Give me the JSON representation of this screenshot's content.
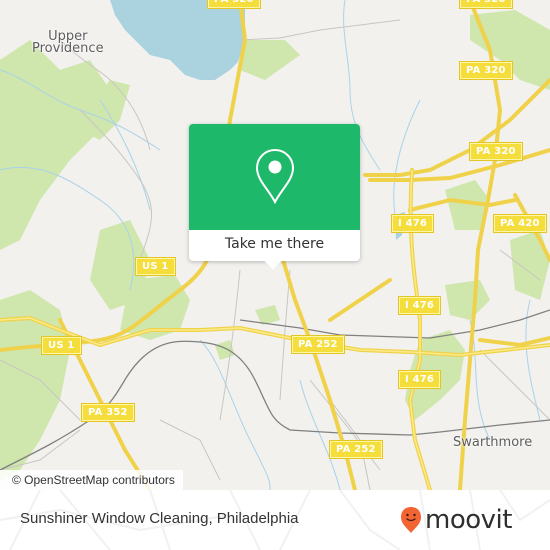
{
  "map": {
    "colors": {
      "background": "#f2f1ee",
      "water": "#aad3df",
      "park": "#c8e3a4",
      "road_major": "#f5dd3c",
      "road_minor": "#bdbcb8",
      "rail": "#7a7a7a",
      "stream": "#a9d2ea"
    },
    "place_labels": [
      {
        "name": "upper-providence",
        "line1": "Upper",
        "line2": "Providence"
      },
      {
        "name": "swarthmore",
        "line1": "Swarthmore",
        "line2": ""
      }
    ],
    "road_shields": [
      {
        "label": "PA 320"
      },
      {
        "label": "PA 320"
      },
      {
        "label": "PA 320"
      },
      {
        "label": "I 476"
      },
      {
        "label": "PA 420"
      },
      {
        "label": "US 1"
      },
      {
        "label": "US 1"
      },
      {
        "label": "I 476"
      },
      {
        "label": "PA 252"
      },
      {
        "label": "I 476"
      },
      {
        "label": "PA 352"
      },
      {
        "label": "PA 252"
      }
    ],
    "attribution": "© OpenStreetMap contributors"
  },
  "popup": {
    "icon": "map-pin-icon",
    "color": "#1db86a",
    "cta_label": "Take me there"
  },
  "footer": {
    "title": "Sunshiner Window Cleaning, Philadelphia",
    "logo_text": "moovit",
    "logo_color": "#f26532"
  }
}
